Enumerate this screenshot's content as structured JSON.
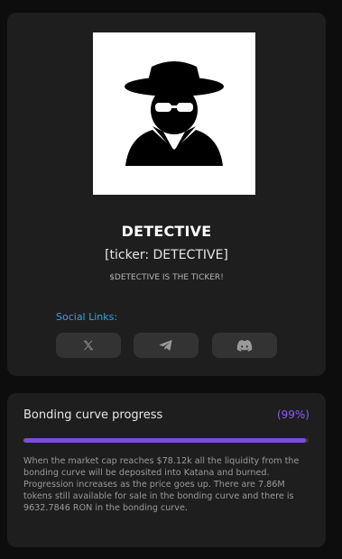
{
  "token": {
    "image_icon": "detective-icon",
    "name": "DETECTIVE",
    "ticker": "[ticker: DETECTIVE]",
    "description": "$DETECTIVE IS THE TICKER!"
  },
  "social": {
    "label": "Social Links:",
    "links": [
      {
        "name": "x",
        "icon": "x-icon"
      },
      {
        "name": "telegram",
        "icon": "telegram-icon"
      },
      {
        "name": "discord",
        "icon": "discord-icon"
      }
    ]
  },
  "bonding": {
    "title": "Bonding curve progress",
    "percent_label": "(99%)",
    "progress": 0.99,
    "description": "When the market cap reaches $78.12k all the liquidity from the bonding curve will be deposited into Katana and burned. Progression increases as the price goes up. There are 7.86M tokens still available for sale in the bonding curve and there is 9632.7846 RON in the bonding curve."
  },
  "colors": {
    "accent_purple": "#7c4ddb",
    "link_blue": "#29a8e6",
    "card_bg": "#1e1e1e"
  }
}
